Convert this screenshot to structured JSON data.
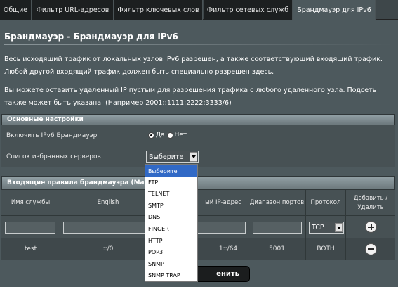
{
  "tabs": [
    {
      "label": "Общие"
    },
    {
      "label": "Фильтр URL-адресов"
    },
    {
      "label": "Фильтр ключевых слов"
    },
    {
      "label": "Фильтр сетевых служб"
    },
    {
      "label": "Брандмауэр для IPv6"
    }
  ],
  "page": {
    "title": "Брандмауэр - Брандмауэр для IPv6",
    "desc1": "Весь исходящий трафик от локальных узлов IPv6 разрешен, а также соответствующий входящий трафик. Любой другой входящий трафик должен быть специально разрешен здесь.",
    "desc2": "Вы можете оставить удаленный IP пустым для разрешения трафика с любого удаленного узла. Подсеть также может быть указана. (Например 2001::1111:2222:3333/6)"
  },
  "basic": {
    "header": "Основные настройки",
    "enable_label": "Включить IPv6 Брандмауэр",
    "yes": "Да",
    "no": "Нет",
    "favorites_label": "Список избранных серверов",
    "favorites_value": "Выберите"
  },
  "rules": {
    "header": "Входящие правила брандмауэра (Мак",
    "columns": {
      "service": "Имя службы",
      "english": "English",
      "remote_ip": "ый IP-адрес",
      "ports": "Диапазон портов",
      "protocol": "Протокол",
      "add_remove": "Добавить / Удалить"
    },
    "protocol_value": "TCP",
    "row": {
      "service": "test",
      "english": "::/0",
      "remote_ip": "1::/64",
      "ports": "5001",
      "protocol": "BOTH"
    }
  },
  "apply_label": "енить",
  "dropdown": {
    "items": [
      "Выберите",
      "FTP",
      "TELNET",
      "SMTP",
      "DNS",
      "FINGER",
      "HTTP",
      "POP3",
      "SNMP",
      "SNMP TRAP"
    ]
  },
  "colors": {
    "background": "#4d595d",
    "tab_bg": "#1c1f20",
    "header_bar": "#7f8c91",
    "selected_item": "#3169c6"
  }
}
